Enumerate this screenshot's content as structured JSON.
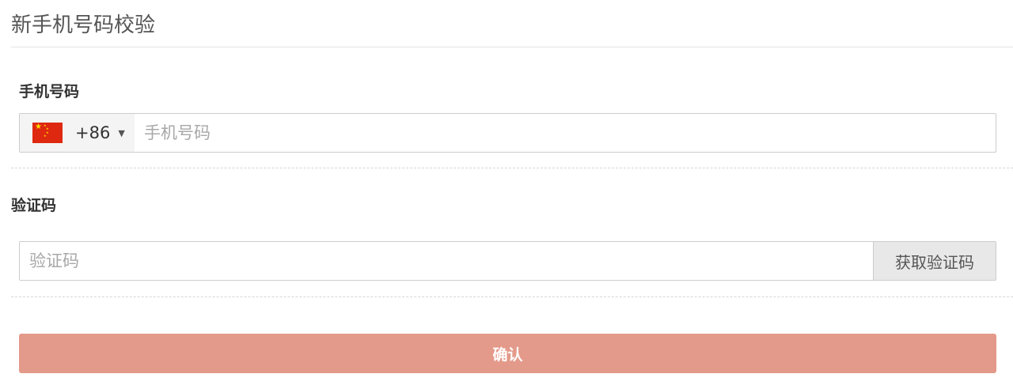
{
  "page": {
    "title": "新手机号码校验"
  },
  "phone_field": {
    "label": "手机号码",
    "country_code": "+86",
    "country_flag": "china-flag-icon",
    "value": "",
    "placeholder": "手机号码"
  },
  "code_field": {
    "label": "验证码",
    "value": "",
    "placeholder": "验证码",
    "get_code_label": "获取验证码"
  },
  "actions": {
    "confirm_label": "确认"
  },
  "colors": {
    "confirm_button": "#e49a8a",
    "flag_red": "#de2910",
    "flag_star": "#ffde00"
  }
}
